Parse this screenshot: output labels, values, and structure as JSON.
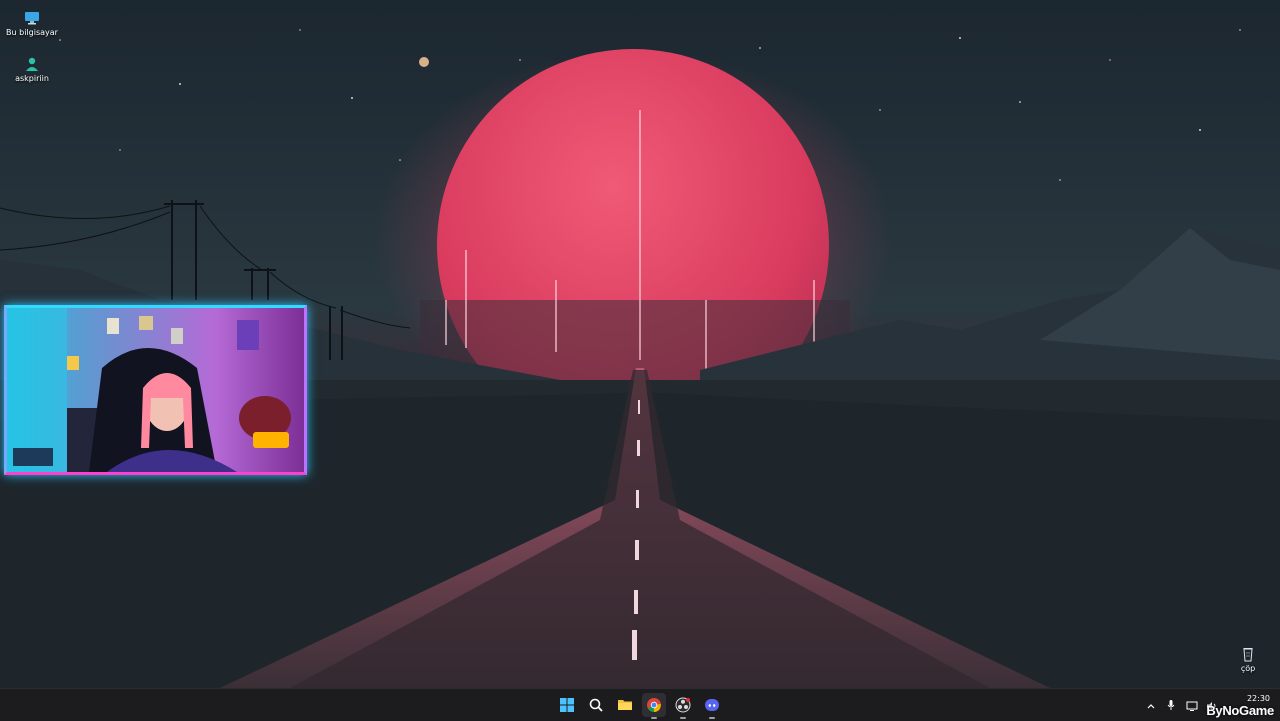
{
  "desktop": {
    "icons": [
      {
        "label": "Bu bilgisayar",
        "icon": "computer-icon"
      },
      {
        "label": "askpiriin",
        "icon": "user-folder-icon"
      },
      {
        "label": "çöp",
        "icon": "recycle-bin-icon"
      }
    ]
  },
  "wallpaper": {
    "theme": "red-moon-over-road",
    "colors": {
      "sky": "#1f2b33",
      "moon": "#e8476a",
      "road": "#3a2c34",
      "glow": "#ff5a7a"
    }
  },
  "webcam_overlay": {
    "frame_colors": {
      "top": "#35d8ff",
      "bottom": "#ff3fd0"
    }
  },
  "taskbar": {
    "apps": [
      {
        "name": "start",
        "icon": "windows-start-icon"
      },
      {
        "name": "search",
        "icon": "search-icon"
      },
      {
        "name": "file-explorer",
        "icon": "folder-icon"
      },
      {
        "name": "chrome",
        "icon": "chrome-icon",
        "active": true
      },
      {
        "name": "obs",
        "icon": "obs-icon",
        "active": true
      },
      {
        "name": "discord",
        "icon": "discord-icon",
        "active": true
      }
    ],
    "tray": {
      "icons": [
        "chevron-up-icon",
        "microphone-icon",
        "display-icon",
        "volume-icon"
      ],
      "time": "22:30"
    }
  },
  "watermark": "ByNoGame"
}
